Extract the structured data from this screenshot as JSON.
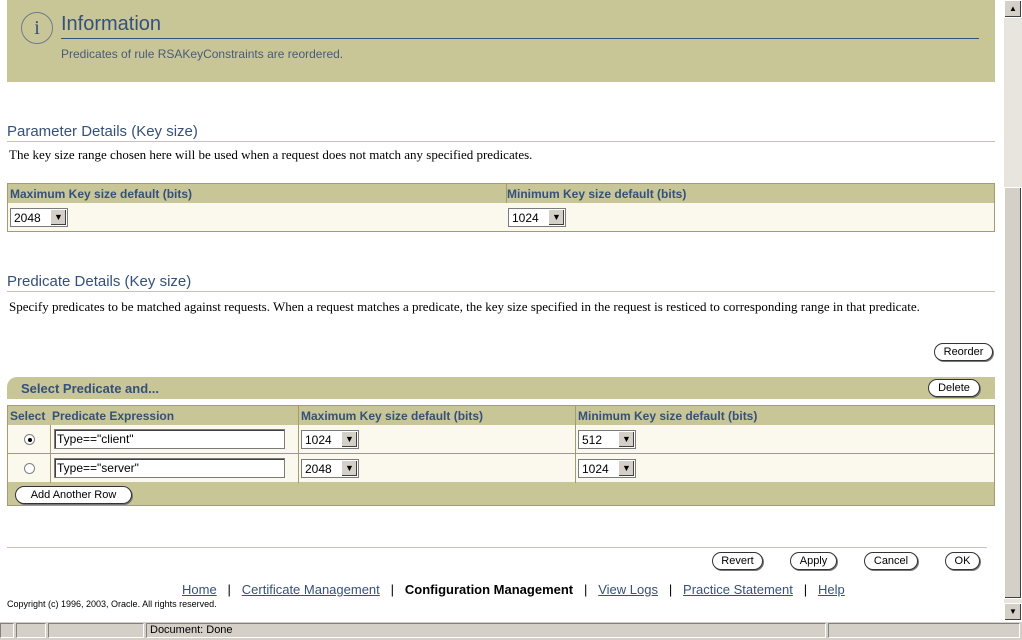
{
  "info": {
    "title": "Information",
    "message": "Predicates of rule RSAKeyConstraints are reordered."
  },
  "parameter_details": {
    "heading": "Parameter Details (Key size)",
    "description": "The key size range chosen here will be used when a request does not match any specified predicates.",
    "max_label": "Maximum Key size default (bits)",
    "min_label": "Minimum Key size default (bits)",
    "max_value": "2048",
    "min_value": "1024"
  },
  "predicate_details": {
    "heading": "Predicate Details (Key size)",
    "description": "Specify predicates to be matched against requests. When a request matches a predicate, the key size specified in the request is resticed to corresponding range in that predicate.",
    "reorder_label": "Reorder",
    "select_bar_label": "Select Predicate and...",
    "delete_label": "Delete",
    "columns": [
      "Select",
      "Predicate Expression",
      "Maximum Key size default (bits)",
      "Minimum Key size default (bits)"
    ],
    "rows": [
      {
        "selected": true,
        "expression": "Type==\"client\"",
        "max": "1024",
        "min": "512"
      },
      {
        "selected": false,
        "expression": "Type==\"server\"",
        "max": "2048",
        "min": "1024"
      }
    ],
    "add_row_label": "Add Another Row"
  },
  "actions": {
    "revert": "Revert",
    "apply": "Apply",
    "cancel": "Cancel",
    "ok": "OK"
  },
  "footer": {
    "links": [
      {
        "label": "Home",
        "current": false
      },
      {
        "label": "Certificate Management",
        "current": false
      },
      {
        "label": "Configuration Management",
        "current": true
      },
      {
        "label": "View Logs",
        "current": false
      },
      {
        "label": "Practice Statement",
        "current": false
      },
      {
        "label": "Help",
        "current": false
      }
    ],
    "copyright": "Copyright (c) 1996, 2003, Oracle. All rights reserved."
  },
  "statusbar": {
    "text": "Document: Done"
  },
  "colors": {
    "accent_tan": "#c8c697",
    "heading_blue": "#35507a"
  }
}
